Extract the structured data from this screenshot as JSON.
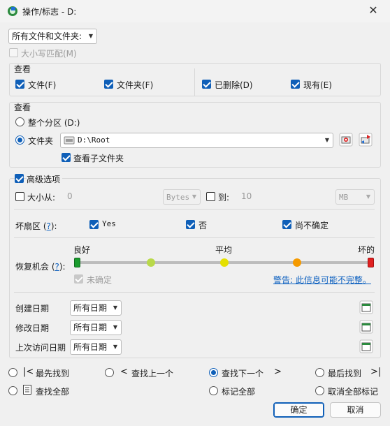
{
  "window": {
    "title": "操作/标志 - D:",
    "close_glyph": "✕"
  },
  "file_filter": {
    "selected": "所有文件和文件夹:"
  },
  "match_case": {
    "label": "大小写匹配(M)",
    "checked": false,
    "enabled": false
  },
  "view_types": {
    "title": "查看",
    "files": {
      "label": "文件(F)",
      "checked": true
    },
    "folders": {
      "label": "文件夹(F)",
      "checked": true
    },
    "deleted": {
      "label": "已删除(D)",
      "checked": true
    },
    "existing": {
      "label": "现有(E)",
      "checked": true
    }
  },
  "view_scope": {
    "title": "查看",
    "whole_partition": {
      "label": "整个分区 (D:)",
      "selected": false
    },
    "folder": {
      "label": "文件夹",
      "selected": true
    },
    "folder_path": "D:\\Root",
    "subfolders": {
      "label": "查看子文件夹",
      "checked": true
    }
  },
  "advanced": {
    "label": "高级选项",
    "checked": true,
    "size_from": {
      "label": "大小从:",
      "value": "0",
      "unit": "Bytes"
    },
    "size_to": {
      "label": "到:",
      "value": "10",
      "unit": "MB"
    },
    "bad_sectors": {
      "label": "坏扇区 (",
      "help": "?",
      "label_end": "):",
      "yes": {
        "label": "Yes",
        "checked": true
      },
      "no": {
        "label": "否",
        "checked": true
      },
      "unknown": {
        "label": "尚不确定",
        "checked": true
      }
    },
    "recovery": {
      "label": "恢复机会 (",
      "help": "?",
      "label_end": "):",
      "good": "良好",
      "average": "平均",
      "bad": "坏的",
      "levels": [
        "#1a9c2e",
        "#b9d94a",
        "#e5e000",
        "#f59a00",
        "#e02020"
      ],
      "undetermined": {
        "label": "未确定",
        "checked": true,
        "enabled": false
      },
      "warning": "警告: 此信息可能不完整。"
    },
    "dates": [
      {
        "label": "创建日期",
        "value": "所有日期"
      },
      {
        "label": "修改日期",
        "value": "所有日期"
      },
      {
        "label": "上次访问日期",
        "value": "所有日期"
      }
    ]
  },
  "actions": {
    "find_first": "最先找到",
    "find_prev": "查找上一个",
    "find_next": "查找下一个",
    "find_last": "最后找到",
    "find_all": "查找全部",
    "mark_all": "标记全部",
    "unmark_all": "取消全部标记",
    "selected": "find_next"
  },
  "buttons": {
    "ok": "确定",
    "cancel": "取消"
  },
  "colors": {
    "accent": "#0f5fb8",
    "link": "#0b5fbf"
  }
}
